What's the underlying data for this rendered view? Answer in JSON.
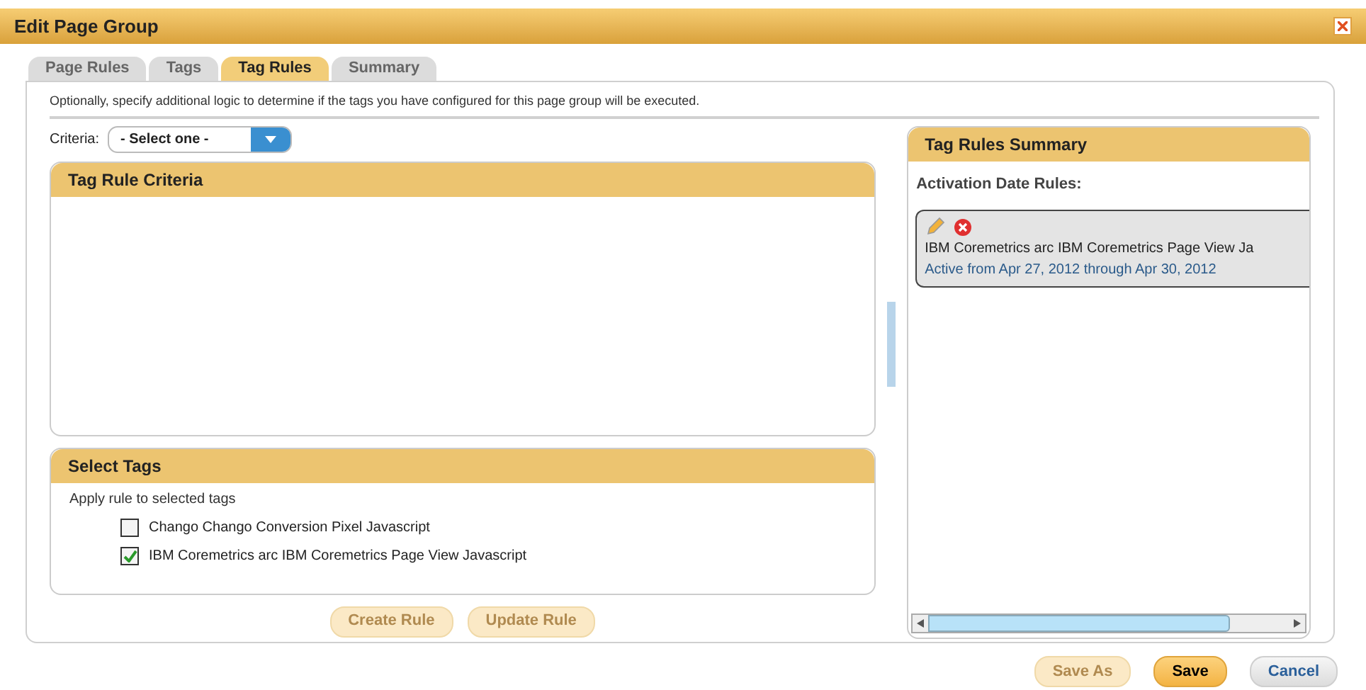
{
  "window": {
    "title": "Edit Page Group"
  },
  "tabs": [
    {
      "label": "Page Rules",
      "selected": false
    },
    {
      "label": "Tags",
      "selected": false
    },
    {
      "label": "Tag Rules",
      "selected": true
    },
    {
      "label": "Summary",
      "selected": false
    }
  ],
  "description": "Optionally, specify additional logic to determine if the tags you have configured for this page group will be executed.",
  "criteria": {
    "label": "Criteria:",
    "value": "- Select one -"
  },
  "tag_rule_criteria": {
    "title": "Tag Rule Criteria"
  },
  "select_tags": {
    "title": "Select Tags",
    "hint": "Apply rule to selected tags",
    "tags": [
      {
        "label": "Chango Chango Conversion Pixel Javascript",
        "checked": false
      },
      {
        "label": "IBM Coremetrics arc IBM Coremetrics Page View Javascript",
        "checked": true
      }
    ]
  },
  "rule_buttons": [
    {
      "label": "Create Rule",
      "disabled": true
    },
    {
      "label": "Update Rule",
      "disabled": true
    }
  ],
  "summary": {
    "title": "Tag Rules Summary",
    "section": "Activation Date Rules:",
    "rules": [
      {
        "name": "IBM Coremetrics arc IBM Coremetrics Page View Ja",
        "period": "Active from Apr 27, 2012 through Apr 30, 2012"
      }
    ]
  },
  "footer_buttons": [
    {
      "label": "Save As",
      "kind": "secondary",
      "disabled": true
    },
    {
      "label": "Save",
      "kind": "primary",
      "disabled": false
    },
    {
      "label": "Cancel",
      "kind": "cancel",
      "disabled": false
    }
  ]
}
